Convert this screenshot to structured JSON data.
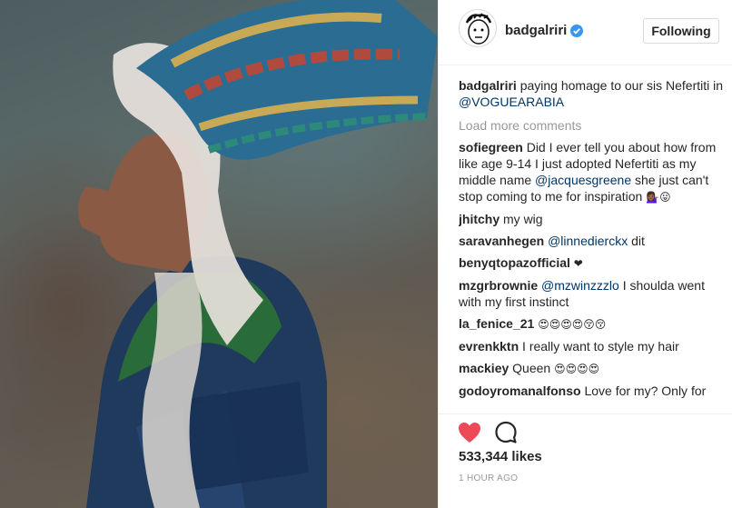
{
  "post": {
    "username": "badgalriri",
    "follow_label": "Following"
  },
  "caption": {
    "username": "badgalriri",
    "text": "paying homage to our sis Nefertiti in",
    "mention": "@VOGUEARABIA"
  },
  "load_more_label": "Load more comments",
  "comments": [
    {
      "username": "sofiegreen",
      "text": "Did I ever tell you about how from like age 9-14 I just adopted Nefertiti as my middle name",
      "mention": "@jacquesgreene",
      "text2": "she just can't stop coming to me for inspiration",
      "emoji": "💁🏾‍♀️😛"
    },
    {
      "username": "jhitchy",
      "text": "my wig"
    },
    {
      "username": "saravanhegen",
      "mention": "@linnedierckx",
      "text2": "dit"
    },
    {
      "username": "benyqtopazofficial",
      "emoji": "❤"
    },
    {
      "username": "mzgrbrownie",
      "mention": "@mzwinzzzlo",
      "text2": "I shoulda went with my first instinct"
    },
    {
      "username": "la_fenice_21",
      "emoji": "😍😍😍😍😚😚"
    },
    {
      "username": "evrenkktn",
      "text": "I really want to style my hair"
    },
    {
      "username": "mackiey",
      "text": "Queen",
      "emoji": "😍😍😍😍"
    },
    {
      "username": "godoyromanalfonso",
      "text": "Love for my? Only for"
    }
  ],
  "likes": "533,344 likes",
  "time": "1 HOUR AGO",
  "colors": {
    "heart": "#ed4956",
    "mention": "#003569",
    "verified": "#3897f0"
  }
}
